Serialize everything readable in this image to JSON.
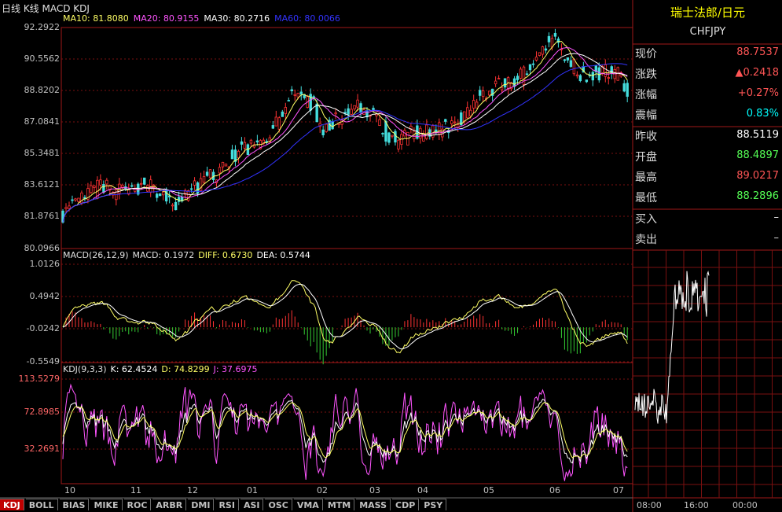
{
  "chart": {
    "title": "日线 K线 MACD KDJ",
    "ma": [
      {
        "label": "MA10: 81.8080",
        "color": "#ffff66"
      },
      {
        "label": "MA20: 80.9155",
        "color": "#ff55ff"
      },
      {
        "label": "MA30: 80.2716",
        "color": "#ffffff"
      },
      {
        "label": "MA60: 80.0066",
        "color": "#3333ff"
      }
    ],
    "price_ticks": [
      "92.2922",
      "90.5562",
      "88.8202",
      "87.0841",
      "85.3481",
      "83.6121",
      "81.8761",
      "80.0966"
    ],
    "macd_header": [
      {
        "label": "MACD(26,12,9)",
        "color": "#e0e0e0"
      },
      {
        "label": "MACD: 0.1972",
        "color": "#e0e0e0"
      },
      {
        "label": "DIFF: 0.6730",
        "color": "#ffff66"
      },
      {
        "label": "DEA: 0.5744",
        "color": "#ffffff"
      }
    ],
    "macd_ticks": [
      "1.0126",
      "0.4942",
      "-0.0242",
      "-0.5549"
    ],
    "kdj_header": [
      {
        "label": "KDJ(9,3,3)",
        "color": "#e0e0e0"
      },
      {
        "label": "K: 62.4524",
        "color": "#ffffff"
      },
      {
        "label": "D: 74.8299",
        "color": "#ffff66"
      },
      {
        "label": "J: 37.6975",
        "color": "#ff55ff"
      }
    ],
    "kdj_ticks": [
      "113.5279",
      "72.8985",
      "32.2691"
    ],
    "months": [
      "10",
      "11",
      "12",
      "01",
      "02",
      "03",
      "04",
      "05",
      "06",
      "07"
    ]
  },
  "tabs": [
    "KDJ",
    "BOLL",
    "BIAS",
    "MIKE",
    "ROC",
    "ARBR",
    "DMI",
    "RSI",
    "ASI",
    "OSC",
    "VMA",
    "MTM",
    "MASS",
    "CDP",
    "PSY"
  ],
  "quote": {
    "name": "瑞士法郎/日元",
    "symbol": "CHFJPY",
    "rows1": [
      {
        "k": "现价",
        "v": "88.7537",
        "color": "#ff5555"
      },
      {
        "k": "涨跌",
        "v": "▲0.2418",
        "color": "#ff5555"
      },
      {
        "k": "涨幅",
        "v": "+0.27%",
        "color": "#ff5555"
      },
      {
        "k": "震幅",
        "v": "0.83%",
        "color": "#00ffff"
      }
    ],
    "rows2": [
      {
        "k": "昨收",
        "v": "88.5119",
        "color": "#ffffff"
      },
      {
        "k": "开盘",
        "v": "88.4897",
        "color": "#55ff55"
      },
      {
        "k": "最高",
        "v": "89.0217",
        "color": "#ff5555"
      },
      {
        "k": "最低",
        "v": "88.2896",
        "color": "#55ff55"
      }
    ],
    "rows3": [
      {
        "k": "买入",
        "v": "–",
        "color": "#e0e0e0"
      },
      {
        "k": "卖出",
        "v": "–",
        "color": "#e0e0e0"
      }
    ]
  },
  "intraday": {
    "times": [
      "08:00",
      "16:00",
      "00:00"
    ]
  }
}
